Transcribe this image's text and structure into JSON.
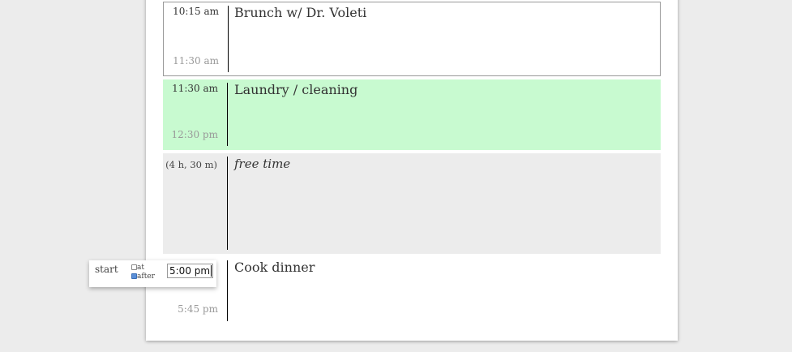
{
  "events": [
    {
      "start": "10:15 am",
      "end": "11:30 am",
      "title": "Brunch w/ Dr. Voleti"
    },
    {
      "start": "11:30 am",
      "end": "12:30 pm",
      "title": "Laundry / cleaning",
      "color": "#c8fad0"
    },
    {
      "duration": "(4 h, 30 m)",
      "title": "free time",
      "color": "#ececec"
    },
    {
      "end": "5:45 pm",
      "title": "Cook dinner"
    }
  ],
  "popup": {
    "label": "start",
    "option_at": "at",
    "option_after": "after",
    "at_checked": false,
    "after_checked": true,
    "time_value": "5:00 pm"
  }
}
